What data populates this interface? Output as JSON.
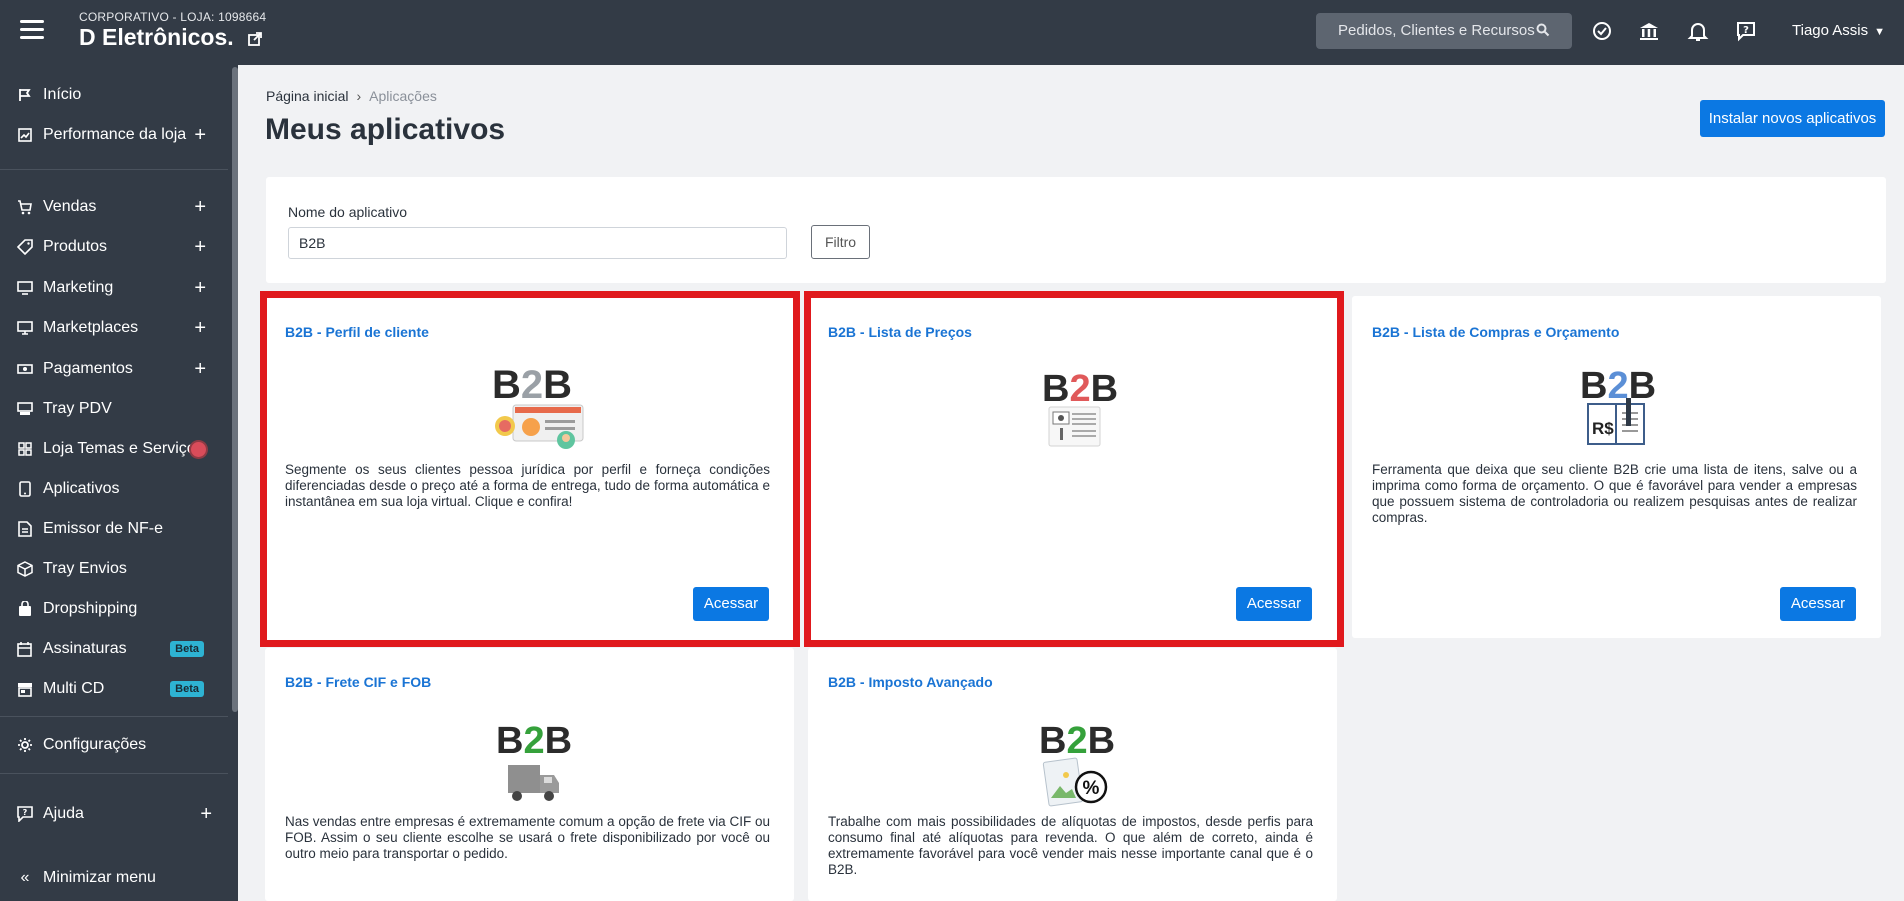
{
  "topbar": {
    "store_sub": "CORPORATIVO - LOJA: 1098664",
    "store_name": "D Eletrônicos.",
    "search_placeholder": "Pedidos, Clientes e Recursos",
    "user_name": "Tiago Assis",
    "icons": [
      "menu-icon",
      "external-link-icon",
      "search-icon",
      "check-circle-icon",
      "bank-icon",
      "bell-icon",
      "help-chat-icon",
      "chevron-down-icon"
    ]
  },
  "sidebar": {
    "items": [
      {
        "label": "Início",
        "icon": "flag-icon"
      },
      {
        "label": "Performance da loja",
        "icon": "chart-icon",
        "expand": "+"
      },
      {
        "label": "Vendas",
        "icon": "cart-icon",
        "expand": "+"
      },
      {
        "label": "Produtos",
        "icon": "tag-icon",
        "expand": "+"
      },
      {
        "label": "Marketing",
        "icon": "monitor-icon",
        "expand": "+"
      },
      {
        "label": "Marketplaces",
        "icon": "desktop-icon",
        "expand": "+"
      },
      {
        "label": "Pagamentos",
        "icon": "money-icon",
        "expand": "+"
      },
      {
        "label": "Tray PDV",
        "icon": "pos-icon"
      },
      {
        "label": "Loja Temas e Serviços",
        "icon": "grid-icon"
      },
      {
        "label": "Aplicativos",
        "icon": "phone-icon"
      },
      {
        "label": "Emissor de NF-e",
        "icon": "document-icon"
      },
      {
        "label": "Tray Envios",
        "icon": "box-icon"
      },
      {
        "label": "Dropshipping",
        "icon": "bag-icon"
      },
      {
        "label": "Assinaturas",
        "icon": "calendar-icon",
        "badge": "Beta"
      },
      {
        "label": "Multi CD",
        "icon": "store-icon",
        "badge": "Beta"
      },
      {
        "label": "Configurações",
        "icon": "gear-icon"
      },
      {
        "label": "Ajuda",
        "icon": "help-icon",
        "expand": "+"
      },
      {
        "label": "Minimizar menu",
        "icon": "double-chevron-left-icon"
      }
    ]
  },
  "breadcrumb": {
    "home": "Página inicial",
    "separator": "›",
    "current": "Aplicações"
  },
  "page_title": "Meus aplicativos",
  "install_button": "Instalar novos aplicativos",
  "filter": {
    "label": "Nome do aplicativo",
    "value": "B2B",
    "button": "Filtro"
  },
  "cards": [
    {
      "title": "B2B - Perfil de cliente",
      "logo": "B2B",
      "logo_colors": [
        "#2b2b2b",
        "#9aa0a6",
        "#2b2b2b"
      ],
      "image_icon": "profile-cards-icon",
      "description": "Segmente os seus clientes pessoa jurídica por perfil e forneça condições diferenciadas desde o preço até a forma de entrega, tudo de forma automática e instantânea em sua loja virtual. Clique e confira!",
      "button": "Acessar",
      "highlighted": true
    },
    {
      "title": "B2B - Lista de Preços",
      "logo": "B2B",
      "logo_colors": [
        "#2b2b2b",
        "#e0595a",
        "#2b2b2b"
      ],
      "image_icon": "price-list-icon",
      "description": "",
      "button": "Acessar",
      "highlighted": true
    },
    {
      "title": "B2B - Lista de Compras e Orçamento",
      "logo": "B2B",
      "logo_colors": [
        "#2b2b2b",
        "#5b8fd6",
        "#2b2b2b"
      ],
      "image_icon": "budget-notebook-icon",
      "image_text": "R$",
      "description": "Ferramenta que deixa que seu cliente B2B crie uma lista de itens, salve ou a imprima como forma de orçamento. O que é favorável para vender a empresas que possuem sistema de controladoria ou realizem pesquisas antes de realizar compras.",
      "button": "Acessar",
      "highlighted": false
    },
    {
      "title": "B2B - Frete CIF e FOB",
      "logo": "B2B",
      "logo_colors": [
        "#2b2b2b",
        "#35a13b",
        "#2b2b2b"
      ],
      "image_icon": "truck-icon",
      "description": "Nas vendas entre empresas é extremamente comum a opção de frete via CIF ou FOB. Assim o seu cliente escolhe se usará o frete disponibilizado por você ou outro meio para transportar o pedido.",
      "button": "",
      "highlighted": false
    },
    {
      "title": "B2B - Imposto Avançado",
      "logo": "B2B",
      "logo_colors": [
        "#2b2b2b",
        "#35a13b",
        "#2b2b2b"
      ],
      "image_icon": "tax-percent-icon",
      "image_text": "%",
      "description": "Trabalhe com mais possibilidades de alíquotas de impostos, desde perfis para consumo final até alíquotas para revenda. O que além de correto, ainda é extremamente favorável para você vender mais nesse importante canal que é o B2B.",
      "button": "",
      "highlighted": false
    }
  ]
}
